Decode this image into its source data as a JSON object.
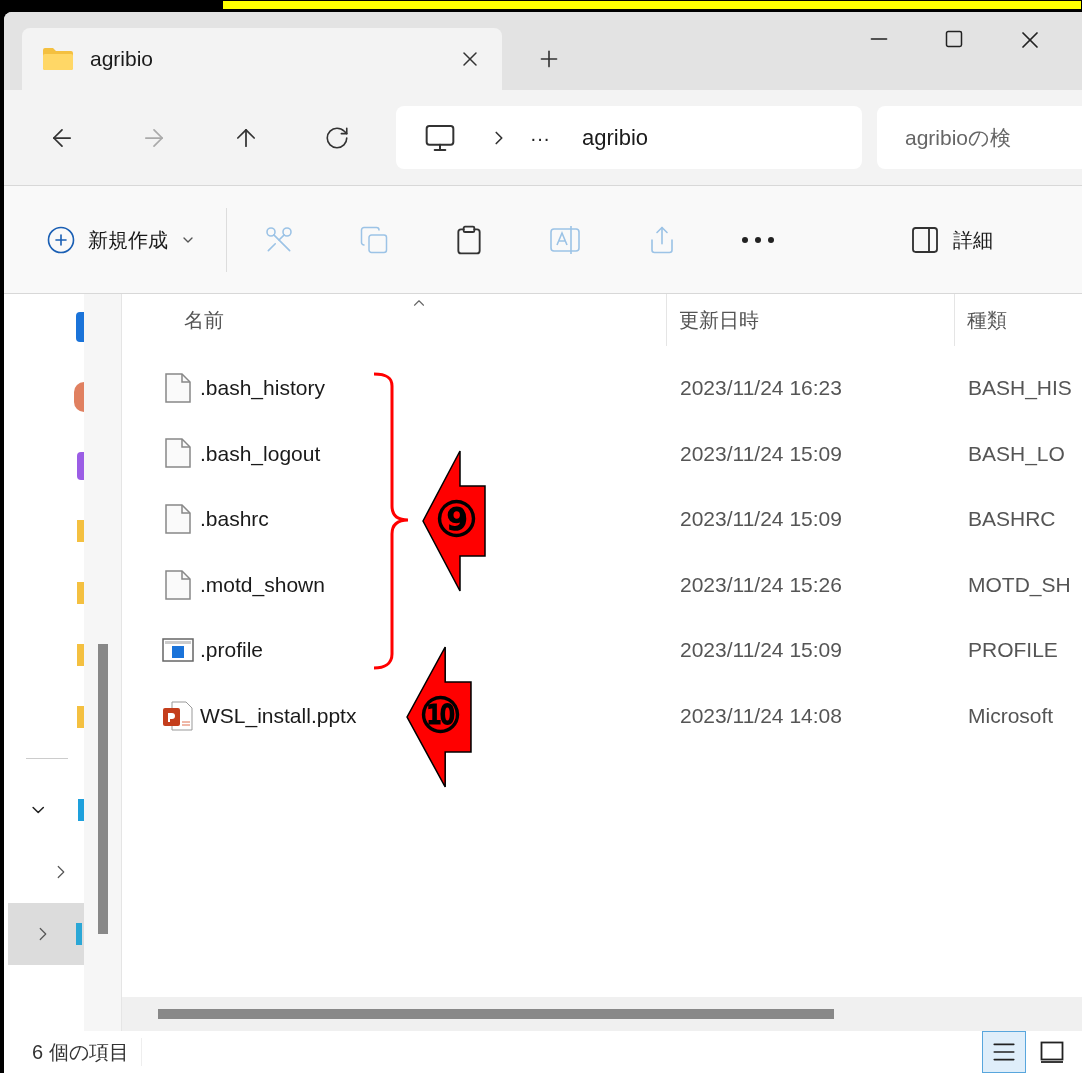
{
  "tab": {
    "title": "agribio"
  },
  "address": {
    "overflow": "···",
    "path": "agribio"
  },
  "search": {
    "placeholder": "agribioの検"
  },
  "toolbar": {
    "new_label": "新規作成",
    "details_label": "詳細"
  },
  "table": {
    "columns": [
      "名前",
      "更新日時",
      "種類"
    ],
    "rows": [
      {
        "kind": "blank",
        "name": ".bash_history",
        "date": "2023/11/24 16:23",
        "type": "BASH_HIS"
      },
      {
        "kind": "blank",
        "name": ".bash_logout",
        "date": "2023/11/24 15:09",
        "type": "BASH_LO"
      },
      {
        "kind": "blank",
        "name": ".bashrc",
        "date": "2023/11/24 15:09",
        "type": "BASHRC"
      },
      {
        "kind": "blank",
        "name": ".motd_shown",
        "date": "2023/11/24 15:26",
        "type": "MOTD_SH"
      },
      {
        "kind": "app",
        "name": ".profile",
        "date": "2023/11/24 15:09",
        "type": "PROFILE"
      },
      {
        "kind": "pptx",
        "name": "WSL_install.pptx",
        "date": "2023/11/24 14:08",
        "type": "Microsoft"
      }
    ]
  },
  "status_bar": {
    "count": "6 個の項目",
    "views": [
      {
        "kind": "details",
        "selected": true
      },
      {
        "kind": "tiles",
        "selected": false
      }
    ]
  },
  "annotations": [
    {
      "label": "⑨"
    },
    {
      "label": "⑩"
    }
  ]
}
